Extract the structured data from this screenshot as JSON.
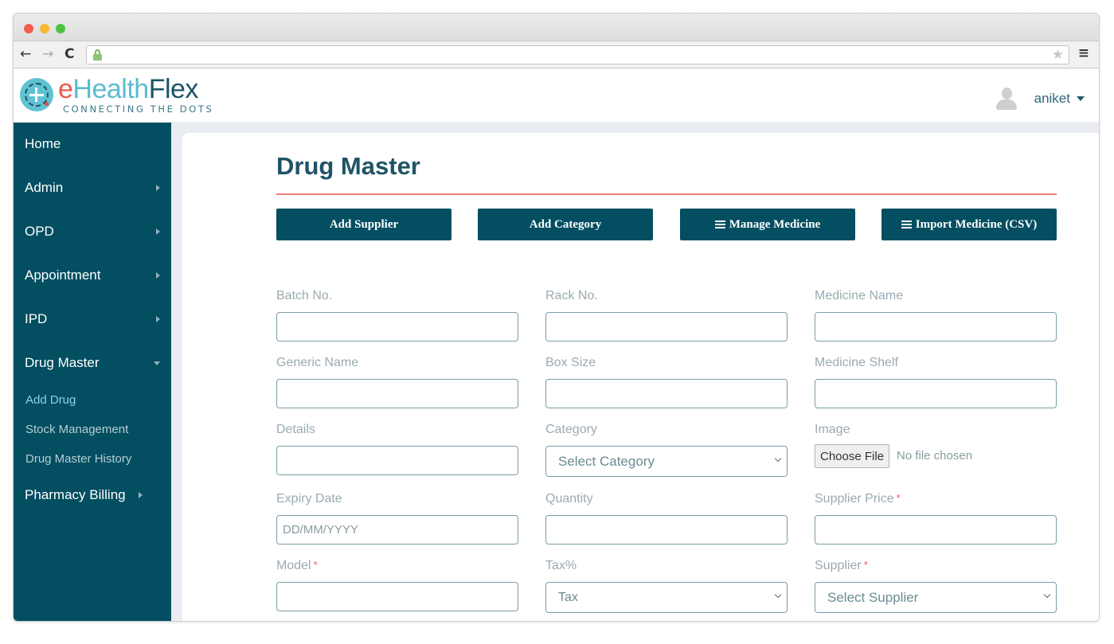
{
  "browser": {
    "back_icon": "←",
    "forward_icon": "→",
    "reload_icon": "C",
    "star_icon": "★",
    "menu_icon": "≡"
  },
  "header": {
    "logo": {
      "part1": "e",
      "part2": "Health",
      "part3": "Flex",
      "tagline": "CONNECTING THE DOTS"
    },
    "user": {
      "name": "aniket"
    }
  },
  "sidebar": {
    "items": [
      {
        "label": "Home",
        "has_arrow": false
      },
      {
        "label": "Admin",
        "has_arrow": true
      },
      {
        "label": "OPD",
        "has_arrow": true
      },
      {
        "label": "Appointment",
        "has_arrow": true
      },
      {
        "label": "IPD",
        "has_arrow": true
      },
      {
        "label": "Drug Master",
        "expanded": true
      },
      {
        "label": "Pharmacy Billing",
        "has_arrow": true
      }
    ],
    "sub_items": [
      {
        "label": "Add Drug",
        "active": true
      },
      {
        "label": "Stock Management"
      },
      {
        "label": "Drug Master History"
      }
    ]
  },
  "main": {
    "title": "Drug Master",
    "buttons": [
      {
        "label": "Add Supplier"
      },
      {
        "label": "Add Category"
      },
      {
        "label": "Manage Medicine",
        "icon": "list-icon"
      },
      {
        "label": "Import Medicine (CSV)",
        "icon": "list-icon"
      }
    ],
    "form": {
      "batch_no": {
        "label": "Batch No.",
        "value": ""
      },
      "rack_no": {
        "label": "Rack No.",
        "value": ""
      },
      "medicine_name": {
        "label": "Medicine Name",
        "value": ""
      },
      "generic_name": {
        "label": "Generic Name",
        "value": ""
      },
      "box_size": {
        "label": "Box Size",
        "value": ""
      },
      "medicine_shelf": {
        "label": "Medicine Shelf",
        "value": ""
      },
      "details": {
        "label": "Details",
        "value": ""
      },
      "category": {
        "label": "Category",
        "selected": "Select Category"
      },
      "image": {
        "label": "Image",
        "button": "Choose File",
        "status": "No file chosen"
      },
      "expiry_date": {
        "label": "Expiry Date",
        "placeholder": "DD/MM/YYYY"
      },
      "quantity": {
        "label": "Quantity",
        "value": ""
      },
      "supplier_price": {
        "label": "Supplier Price",
        "required": "*"
      },
      "model": {
        "label": "Model",
        "required": "*"
      },
      "tax": {
        "label": "Tax%",
        "selected": "Tax"
      },
      "supplier": {
        "label": "Supplier",
        "required": "*",
        "selected": "Select Supplier"
      }
    }
  }
}
